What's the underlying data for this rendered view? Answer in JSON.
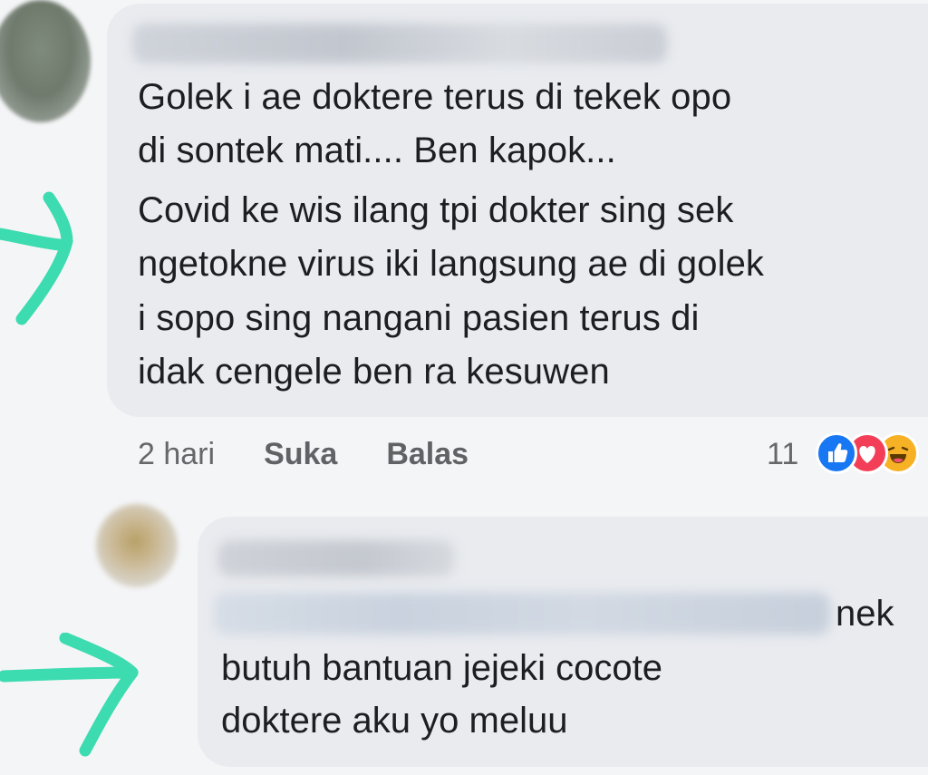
{
  "comment": {
    "lines": [
      "Golek i ae doktere terus di tekek opo",
      "di sontek mati....  Ben kapok...",
      "Covid ke wis ilang tpi dokter sing sek",
      "ngetokne virus iki langsung ae di golek",
      "i sopo sing nangani pasien  terus di",
      "idak cengele ben ra kesuwen"
    ],
    "time": "2 hari",
    "like_label": "Suka",
    "reply_label": "Balas",
    "reaction_count": "11",
    "reactions": [
      "like-icon",
      "love-icon",
      "haha-icon"
    ]
  },
  "reply": {
    "trailing_word": "nek",
    "lines": [
      "butuh bantuan jejeki cocote",
      "doktere aku yo meluu"
    ]
  },
  "colors": {
    "bubble": "#e9ebef",
    "annotation_arrow": "#3ddbb0",
    "like": "#1877f2",
    "love": "#f33e58",
    "haha": "#f7b125"
  }
}
